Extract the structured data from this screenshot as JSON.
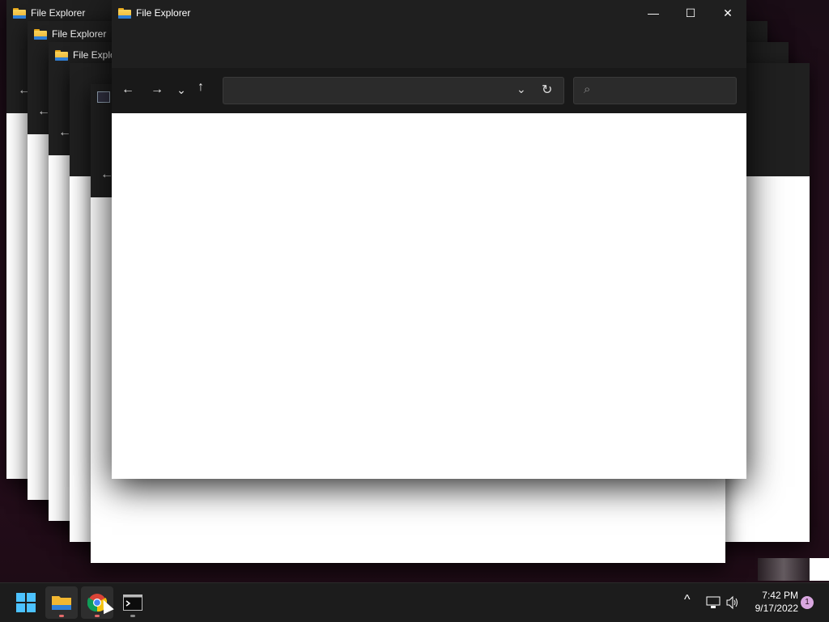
{
  "desktop": {
    "background": "#240d1b"
  },
  "windows": [
    {
      "title": "File Explorer"
    },
    {
      "title": "File Explorer"
    },
    {
      "title": "File Explo"
    },
    {
      "title": "File Explorer"
    }
  ],
  "active_window": {
    "title": "File Explorer",
    "controls": {
      "minimize": "—",
      "maximize": "☐",
      "close": "✕"
    },
    "nav": {
      "back": "←",
      "forward": "→",
      "recent": "⌄",
      "up": "↑"
    },
    "address": {
      "value": "",
      "dropdown": "⌄",
      "refresh": "↻"
    },
    "search": {
      "placeholder": "",
      "icon": "⌕"
    }
  },
  "taskbar": {
    "items": [
      {
        "name": "start",
        "icon": "windows-logo-icon"
      },
      {
        "name": "file-explorer",
        "icon": "folder-icon",
        "running": true
      },
      {
        "name": "chrome",
        "icon": "chrome-icon",
        "running": true
      },
      {
        "name": "terminal",
        "icon": "terminal-icon",
        "running": true
      }
    ],
    "tray": {
      "chevron": "^",
      "time": "7:42 PM",
      "date": "9/17/2022",
      "notifications": "1"
    }
  }
}
